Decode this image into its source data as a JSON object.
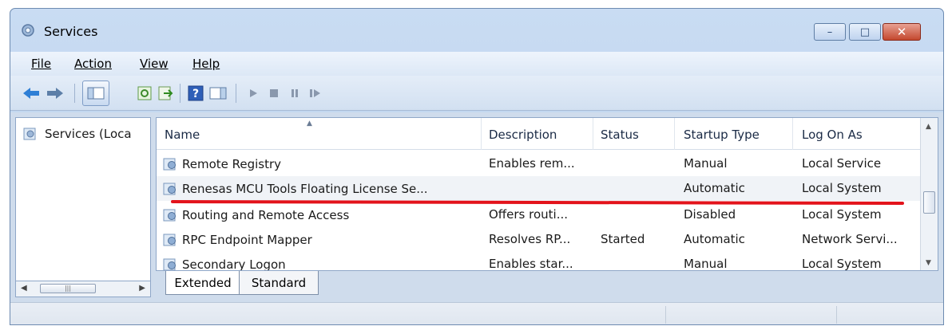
{
  "window": {
    "title": "Services",
    "icon": "services-gear-icon",
    "controls": {
      "minimize": "minimize-icon",
      "maximize": "maximize-icon",
      "close": "close-icon"
    }
  },
  "menu": [
    {
      "label": "File"
    },
    {
      "label": "Action"
    },
    {
      "label": "View"
    },
    {
      "label": "Help"
    }
  ],
  "toolbar": {
    "items": [
      "back-arrow-icon",
      "forward-arrow-icon",
      "show-hide-console-tree-icon",
      "refresh-icon",
      "export-list-icon",
      "help-icon",
      "properties-pane-icon",
      "start-service-icon",
      "stop-service-icon",
      "pause-service-icon",
      "resume-service-icon"
    ]
  },
  "tree": {
    "root_label": "Services (Loca"
  },
  "list": {
    "columns": [
      "Name",
      "Description",
      "Status",
      "Startup Type",
      "Log On As"
    ],
    "rows": [
      {
        "name": "Remote Registry",
        "description": "Enables rem...",
        "status": "",
        "startup": "Manual",
        "logon": "Local Service"
      },
      {
        "name": "Renesas MCU Tools Floating License Se...",
        "description": "",
        "status": "",
        "startup": "Automatic",
        "logon": "Local System"
      },
      {
        "name": "Routing and Remote Access",
        "description": "Offers routi...",
        "status": "",
        "startup": "Disabled",
        "logon": "Local System"
      },
      {
        "name": "RPC Endpoint Mapper",
        "description": "Resolves RP...",
        "status": "Started",
        "startup": "Automatic",
        "logon": "Network Servi..."
      },
      {
        "name": "Secondary Logon",
        "description": "Enables star...",
        "status": "",
        "startup": "Manual",
        "logon": "Local System"
      }
    ],
    "highlight_color": "#e3131b"
  },
  "tabs": [
    {
      "label": "Extended"
    },
    {
      "label": "Standard"
    }
  ],
  "colors": {
    "title_gradient": "#c9dcf3",
    "close_button": "#c4482f",
    "underline_annotation": "#e3131b"
  }
}
